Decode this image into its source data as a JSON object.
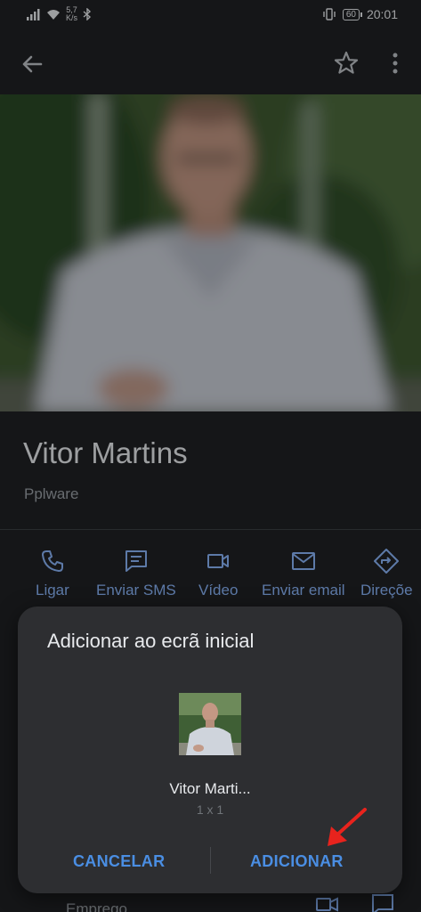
{
  "status_bar": {
    "speed_value": "5,7",
    "speed_unit": "K/s",
    "battery": "60",
    "time": "20:01"
  },
  "app_bar": {
    "back_icon": "arrow-back-icon",
    "favorite_icon": "star-outline-icon",
    "more_icon": "more-vert-icon"
  },
  "contact": {
    "name": "Vitor Martins",
    "company": "Pplware"
  },
  "actions": [
    {
      "label": "Ligar",
      "icon": "phone-icon"
    },
    {
      "label": "Enviar SMS",
      "icon": "message-icon"
    },
    {
      "label": "Vídeo",
      "icon": "videocam-icon"
    },
    {
      "label": "Enviar email",
      "icon": "email-icon"
    },
    {
      "label": "Direçõe",
      "icon": "directions-icon"
    }
  ],
  "background_section": {
    "label": "Emprego"
  },
  "dialog": {
    "title": "Adicionar ao ecrã inicial",
    "shortcut_name": "Vitor Marti...",
    "shortcut_size": "1 x 1",
    "cancel_label": "CANCELAR",
    "add_label": "ADICIONAR"
  },
  "colors": {
    "background": "#202124",
    "dialog": "#2d2e31",
    "accent": "#8ab4f8",
    "dialog_button": "#4a8ee3",
    "annotation_arrow": "#e8231d"
  }
}
